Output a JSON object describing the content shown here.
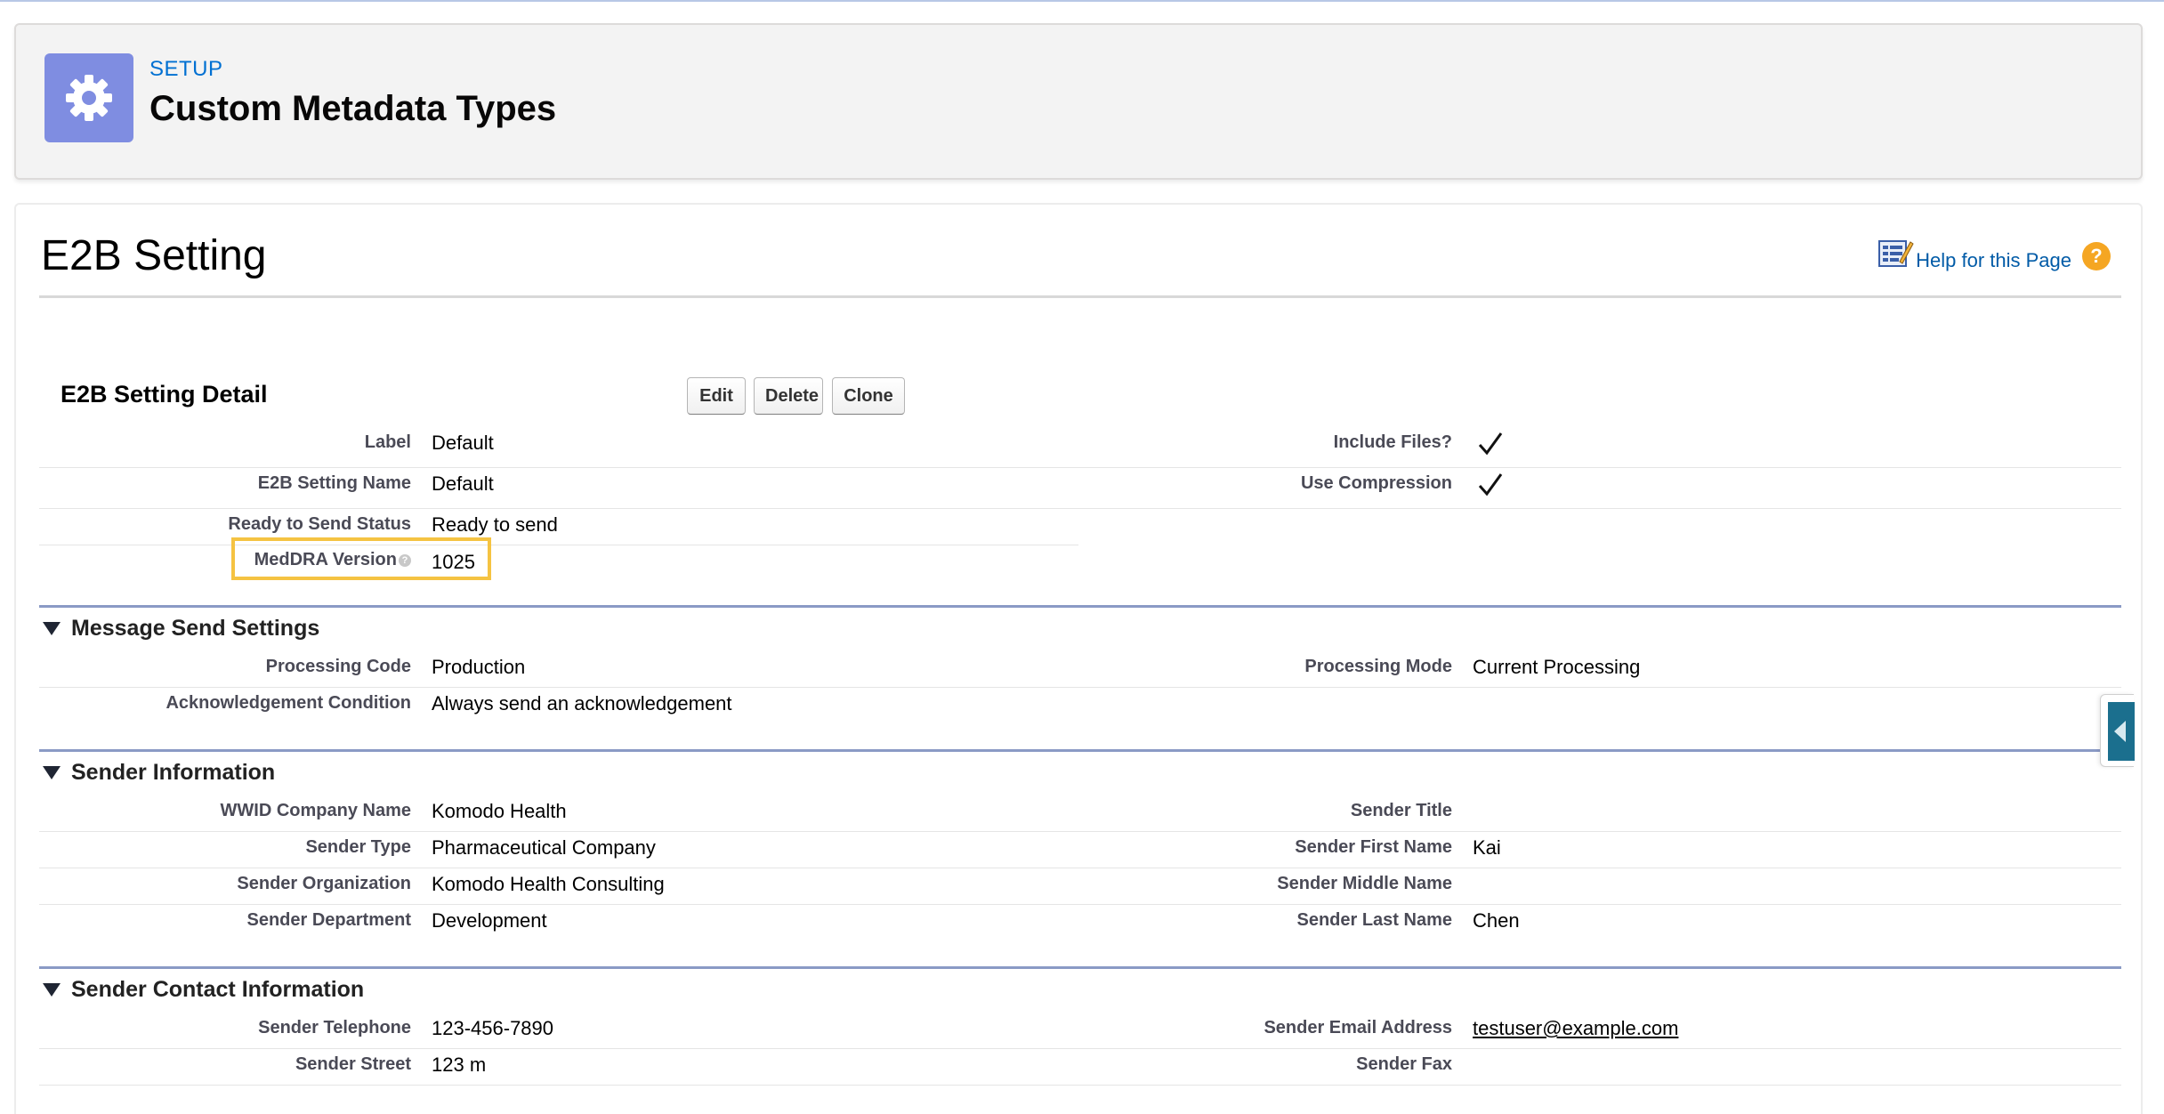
{
  "header": {
    "kicker": "SETUP",
    "title": "Custom Metadata Types",
    "icon": "gear-icon"
  },
  "page": {
    "title": "E2B Setting",
    "help_link": "Help for this Page",
    "help_icon": "question-icon"
  },
  "detail": {
    "title": "E2B Setting Detail",
    "buttons": {
      "edit": "Edit",
      "delete": "Delete",
      "clone": "Clone"
    },
    "left": [
      {
        "label": "Label",
        "value": "Default"
      },
      {
        "label": "E2B Setting Name",
        "value": "Default"
      },
      {
        "label": "Ready to Send Status",
        "value": "Ready to send"
      },
      {
        "label": "MedDRA Version",
        "value": "1025"
      }
    ],
    "right": [
      {
        "label": "Include Files?",
        "checked": true
      },
      {
        "label": "Use Compression",
        "checked": true
      }
    ]
  },
  "message_send": {
    "title": "Message Send Settings",
    "processing_code": {
      "label": "Processing Code",
      "value": "Production"
    },
    "processing_mode": {
      "label": "Processing Mode",
      "value": "Current Processing"
    },
    "ack_condition": {
      "label": "Acknowledgement Condition",
      "value": "Always send an acknowledgement"
    }
  },
  "sender_info": {
    "title": "Sender Information",
    "wwid": {
      "label": "WWID Company Name",
      "value": "Komodo Health"
    },
    "sender_title": {
      "label": "Sender Title",
      "value": ""
    },
    "sender_type": {
      "label": "Sender Type",
      "value": "Pharmaceutical Company"
    },
    "first_name": {
      "label": "Sender First Name",
      "value": "Kai"
    },
    "organization": {
      "label": "Sender Organization",
      "value": "Komodo Health Consulting"
    },
    "middle_name": {
      "label": "Sender Middle Name",
      "value": ""
    },
    "department": {
      "label": "Sender Department",
      "value": "Development"
    },
    "last_name": {
      "label": "Sender Last Name",
      "value": "Chen"
    }
  },
  "sender_contact": {
    "title": "Sender Contact Information",
    "telephone": {
      "label": "Sender Telephone",
      "value": "123-456-7890"
    },
    "email": {
      "label": "Sender Email Address",
      "value": "testuser@example.com"
    },
    "street": {
      "label": "Sender Street",
      "value": "123 m"
    },
    "fax": {
      "label": "Sender Fax",
      "value": ""
    }
  },
  "colors": {
    "accent": "#0070d2",
    "icon_bg": "#7f8de1",
    "highlight": "#f5c342",
    "section_rule": "#8a9ac5"
  }
}
